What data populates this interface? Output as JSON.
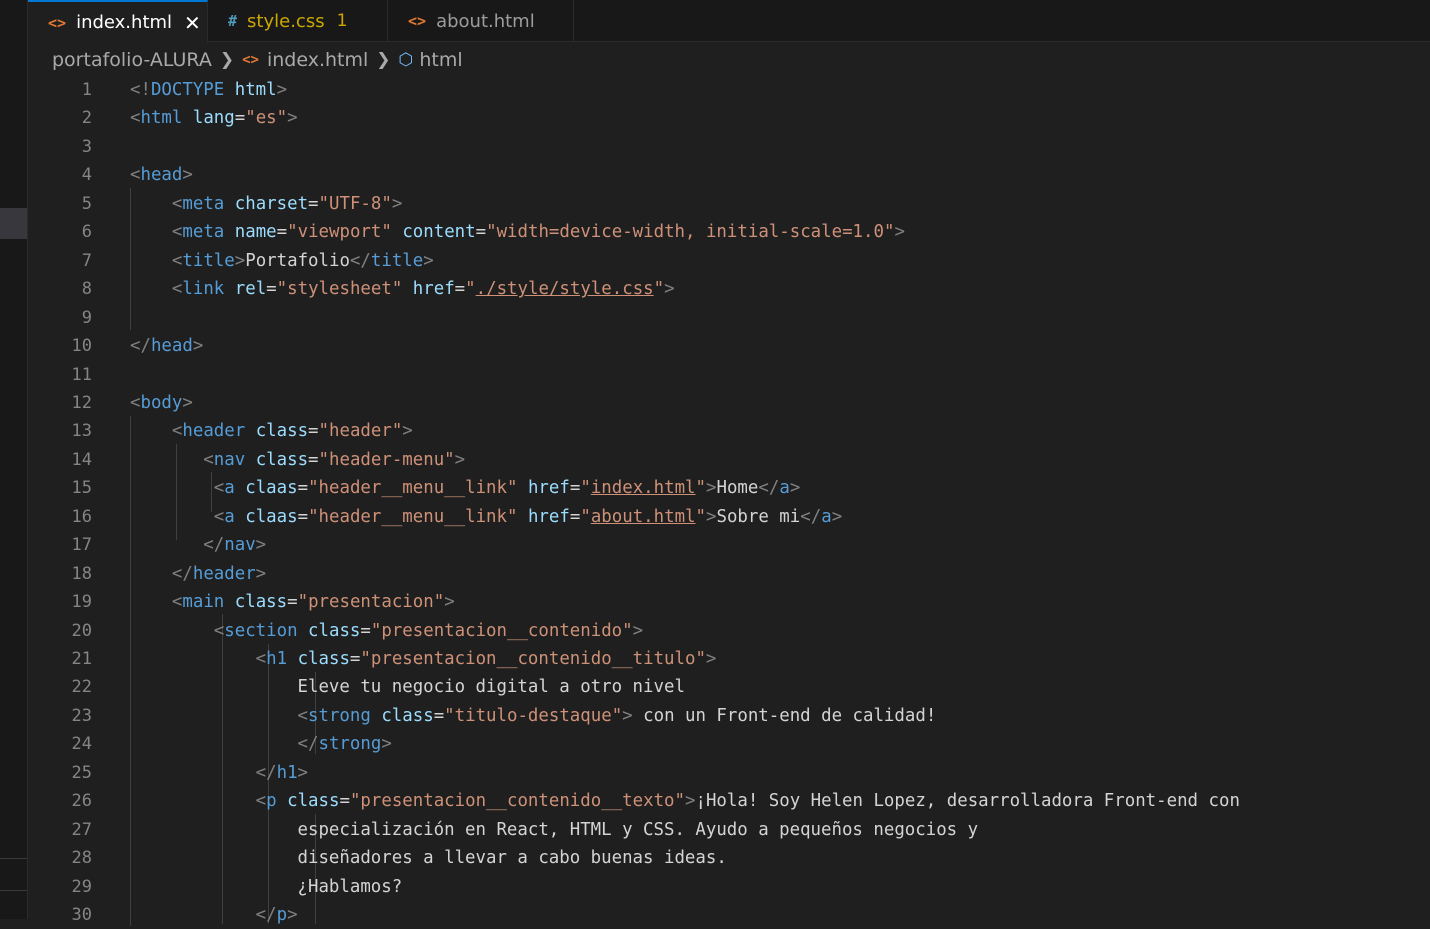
{
  "tabs": [
    {
      "icon": "<>",
      "label": "index.html",
      "close": "✕"
    },
    {
      "icon": "#",
      "label": "style.css",
      "badge": "1"
    },
    {
      "icon": "<>",
      "label": "about.html"
    }
  ],
  "breadcrumb": {
    "folder": "portafolio-ALURA",
    "file": "index.html",
    "element": "html"
  },
  "editor": {
    "line_numbers": [
      "1",
      "2",
      "3",
      "4",
      "5",
      "6",
      "7",
      "8",
      "9",
      "10",
      "11",
      "12",
      "13",
      "14",
      "15",
      "16",
      "17",
      "18",
      "19",
      "20",
      "21",
      "22",
      "23",
      "24",
      "25",
      "26",
      "27",
      "28",
      "29",
      "30"
    ],
    "lines": [
      [
        [
          "br",
          "<!"
        ],
        [
          "tag",
          "DOCTYPE"
        ],
        [
          "txt",
          " "
        ],
        [
          "attr",
          "html"
        ],
        [
          "br",
          ">"
        ]
      ],
      [
        [
          "br",
          "<"
        ],
        [
          "tag",
          "html"
        ],
        [
          "txt",
          " "
        ],
        [
          "attr",
          "lang"
        ],
        [
          "txt",
          "="
        ],
        [
          "str",
          "\"es\""
        ],
        [
          "br",
          ">"
        ]
      ],
      [],
      [
        [
          "br",
          "<"
        ],
        [
          "tag",
          "head"
        ],
        [
          "br",
          ">"
        ]
      ],
      [
        [
          "txt",
          "    "
        ],
        [
          "br",
          "<"
        ],
        [
          "tag",
          "meta"
        ],
        [
          "txt",
          " "
        ],
        [
          "attr",
          "charset"
        ],
        [
          "txt",
          "="
        ],
        [
          "str",
          "\"UTF-8\""
        ],
        [
          "br",
          ">"
        ]
      ],
      [
        [
          "txt",
          "    "
        ],
        [
          "br",
          "<"
        ],
        [
          "tag",
          "meta"
        ],
        [
          "txt",
          " "
        ],
        [
          "attr",
          "name"
        ],
        [
          "txt",
          "="
        ],
        [
          "str",
          "\"viewport\""
        ],
        [
          "txt",
          " "
        ],
        [
          "attr",
          "content"
        ],
        [
          "txt",
          "="
        ],
        [
          "str",
          "\"width=device-width, initial-scale=1.0\""
        ],
        [
          "br",
          ">"
        ]
      ],
      [
        [
          "txt",
          "    "
        ],
        [
          "br",
          "<"
        ],
        [
          "tag",
          "title"
        ],
        [
          "br",
          ">"
        ],
        [
          "txt",
          "Portafolio"
        ],
        [
          "br",
          "</"
        ],
        [
          "tag",
          "title"
        ],
        [
          "br",
          ">"
        ]
      ],
      [
        [
          "txt",
          "    "
        ],
        [
          "br",
          "<"
        ],
        [
          "tag",
          "link"
        ],
        [
          "txt",
          " "
        ],
        [
          "attr",
          "rel"
        ],
        [
          "txt",
          "="
        ],
        [
          "str",
          "\"stylesheet\""
        ],
        [
          "txt",
          " "
        ],
        [
          "attr",
          "href"
        ],
        [
          "txt",
          "="
        ],
        [
          "str",
          "\""
        ],
        [
          "strlink",
          "./style/style.css"
        ],
        [
          "str",
          "\""
        ],
        [
          "br",
          ">"
        ]
      ],
      [],
      [
        [
          "br",
          "</"
        ],
        [
          "tag",
          "head"
        ],
        [
          "br",
          ">"
        ]
      ],
      [],
      [
        [
          "br",
          "<"
        ],
        [
          "tag",
          "body"
        ],
        [
          "br",
          ">"
        ]
      ],
      [
        [
          "txt",
          "    "
        ],
        [
          "br",
          "<"
        ],
        [
          "tag",
          "header"
        ],
        [
          "txt",
          " "
        ],
        [
          "attr",
          "class"
        ],
        [
          "txt",
          "="
        ],
        [
          "str",
          "\"header\""
        ],
        [
          "br",
          ">"
        ]
      ],
      [
        [
          "txt",
          "       "
        ],
        [
          "br",
          "<"
        ],
        [
          "tag",
          "nav"
        ],
        [
          "txt",
          " "
        ],
        [
          "attr",
          "class"
        ],
        [
          "txt",
          "="
        ],
        [
          "str",
          "\"header-menu\""
        ],
        [
          "br",
          ">"
        ]
      ],
      [
        [
          "txt",
          "        "
        ],
        [
          "br",
          "<"
        ],
        [
          "tag",
          "a"
        ],
        [
          "txt",
          " "
        ],
        [
          "attr",
          "claas"
        ],
        [
          "txt",
          "="
        ],
        [
          "str",
          "\"header__menu__link\""
        ],
        [
          "txt",
          " "
        ],
        [
          "attr",
          "href"
        ],
        [
          "txt",
          "="
        ],
        [
          "str",
          "\""
        ],
        [
          "strlink",
          "index.html"
        ],
        [
          "str",
          "\""
        ],
        [
          "br",
          ">"
        ],
        [
          "txt",
          "Home"
        ],
        [
          "br",
          "</"
        ],
        [
          "tag",
          "a"
        ],
        [
          "br",
          ">"
        ]
      ],
      [
        [
          "txt",
          "        "
        ],
        [
          "br",
          "<"
        ],
        [
          "tag",
          "a"
        ],
        [
          "txt",
          " "
        ],
        [
          "attr",
          "claas"
        ],
        [
          "txt",
          "="
        ],
        [
          "str",
          "\"header__menu__link\""
        ],
        [
          "txt",
          " "
        ],
        [
          "attr",
          "href"
        ],
        [
          "txt",
          "="
        ],
        [
          "str",
          "\""
        ],
        [
          "strlink",
          "about.html"
        ],
        [
          "str",
          "\""
        ],
        [
          "br",
          ">"
        ],
        [
          "txt",
          "Sobre mi"
        ],
        [
          "br",
          "</"
        ],
        [
          "tag",
          "a"
        ],
        [
          "br",
          ">"
        ]
      ],
      [
        [
          "txt",
          "       "
        ],
        [
          "br",
          "</"
        ],
        [
          "tag",
          "nav"
        ],
        [
          "br",
          ">"
        ]
      ],
      [
        [
          "txt",
          "    "
        ],
        [
          "br",
          "</"
        ],
        [
          "tag",
          "header"
        ],
        [
          "br",
          ">"
        ]
      ],
      [
        [
          "txt",
          "    "
        ],
        [
          "br",
          "<"
        ],
        [
          "tag",
          "main"
        ],
        [
          "txt",
          " "
        ],
        [
          "attr",
          "class"
        ],
        [
          "txt",
          "="
        ],
        [
          "str",
          "\"presentacion\""
        ],
        [
          "br",
          ">"
        ]
      ],
      [
        [
          "txt",
          "        "
        ],
        [
          "br",
          "<"
        ],
        [
          "tag",
          "section"
        ],
        [
          "txt",
          " "
        ],
        [
          "attr",
          "class"
        ],
        [
          "txt",
          "="
        ],
        [
          "str",
          "\"presentacion__contenido\""
        ],
        [
          "br",
          ">"
        ]
      ],
      [
        [
          "txt",
          "            "
        ],
        [
          "br",
          "<"
        ],
        [
          "tag",
          "h1"
        ],
        [
          "txt",
          " "
        ],
        [
          "attr",
          "class"
        ],
        [
          "txt",
          "="
        ],
        [
          "str",
          "\"presentacion__contenido__titulo\""
        ],
        [
          "br",
          ">"
        ]
      ],
      [
        [
          "txt",
          "                Eleve tu negocio digital a otro nivel"
        ]
      ],
      [
        [
          "txt",
          "                "
        ],
        [
          "br",
          "<"
        ],
        [
          "tag",
          "strong"
        ],
        [
          "txt",
          " "
        ],
        [
          "attr",
          "class"
        ],
        [
          "txt",
          "="
        ],
        [
          "str",
          "\"titulo-destaque\""
        ],
        [
          "br",
          ">"
        ],
        [
          "txt",
          " con un Front-end de calidad!"
        ]
      ],
      [
        [
          "txt",
          "                "
        ],
        [
          "br",
          "</"
        ],
        [
          "tag",
          "strong"
        ],
        [
          "br",
          ">"
        ]
      ],
      [
        [
          "txt",
          "            "
        ],
        [
          "br",
          "</"
        ],
        [
          "tag",
          "h1"
        ],
        [
          "br",
          ">"
        ]
      ],
      [
        [
          "txt",
          "            "
        ],
        [
          "br",
          "<"
        ],
        [
          "tag",
          "p"
        ],
        [
          "txt",
          " "
        ],
        [
          "attr",
          "class"
        ],
        [
          "txt",
          "="
        ],
        [
          "str",
          "\"presentacion__contenido__texto\""
        ],
        [
          "br",
          ">"
        ],
        [
          "txt",
          "¡Hola! Soy Helen Lopez, desarrolladora Front-end con"
        ]
      ],
      [
        [
          "txt",
          "                especialización en React, HTML y CSS. Ayudo a pequeños negocios y"
        ]
      ],
      [
        [
          "txt",
          "                diseñadores a llevar a cabo buenas ideas."
        ]
      ],
      [
        [
          "txt",
          "                ¿Hablamos?"
        ]
      ],
      [
        [
          "txt",
          "            "
        ],
        [
          "br",
          "</"
        ],
        [
          "tag",
          "p"
        ],
        [
          "br",
          ">"
        ]
      ]
    ]
  }
}
